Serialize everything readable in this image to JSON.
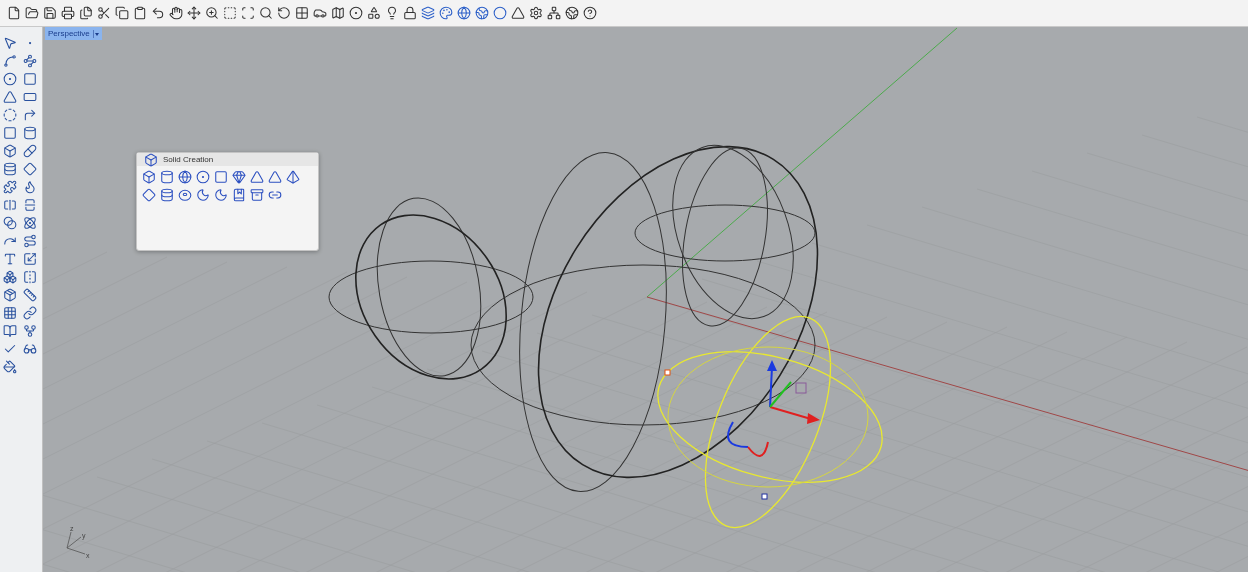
{
  "viewport": {
    "tab": {
      "label": "Perspective",
      "selected": true
    },
    "axis_labels": [
      "z",
      "y",
      "x"
    ]
  },
  "floating_panel": {
    "title": "Solid Creation"
  }
}
